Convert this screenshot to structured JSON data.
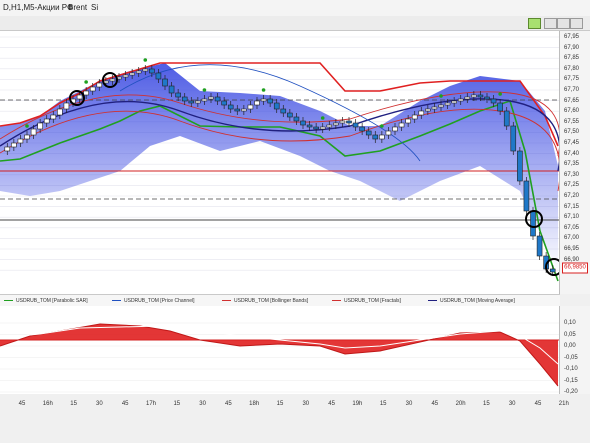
{
  "window": {
    "tabs": [
      "D,H1,M5-Акции РФ",
      "Brent",
      "Si"
    ]
  },
  "toolbar": {
    "buttons": [
      "chart-tool",
      "window-min",
      "window-max",
      "window-close"
    ]
  },
  "price_axis": {
    "labels": [
      "67,95",
      "67,90",
      "67,85",
      "67,80",
      "67,75",
      "67,70",
      "67,65",
      "67,60",
      "67,55",
      "67,50",
      "67,45",
      "67,40",
      "67,35",
      "67,30",
      "67,25",
      "67,20",
      "67,15",
      "67,10",
      "67,05",
      "67,00",
      "66,95",
      "66,90",
      "66,85"
    ],
    "current_price": "66,9850"
  },
  "legend": [
    {
      "label": "USDRUB_TOM [Parabolic SAR]",
      "color": "#20a020"
    },
    {
      "label": "USDRUB_TOM [Price Channel]",
      "color": "#2050c0"
    },
    {
      "label": "USDRUB_TOM [Bollinger Bands]",
      "color": "#d03030"
    },
    {
      "label": "USDRUB_TOM [Fractals]",
      "color": "#d03030"
    },
    {
      "label": "USDRUB_TOM [Moving Average]",
      "color": "#202080"
    }
  ],
  "oscillator_axis": {
    "labels": [
      "0,10",
      "0,05",
      "0,00",
      "-0,05",
      "-0,10",
      "-0,15",
      "-0,20"
    ]
  },
  "time_axis": {
    "labels": [
      "45",
      "16h",
      "15",
      "30",
      "45",
      "17h",
      "15",
      "30",
      "45",
      "18h",
      "15",
      "30",
      "45",
      "19h",
      "15",
      "30",
      "45",
      "20h",
      "15",
      "30",
      "45",
      "21h"
    ]
  },
  "colors": {
    "bull_candle": "#ffffff",
    "bear_candle": "#1f78c8",
    "price_channel": "#e02020",
    "parabolic_sar": "#20a020",
    "oscillator_fill": "#e02020"
  }
}
